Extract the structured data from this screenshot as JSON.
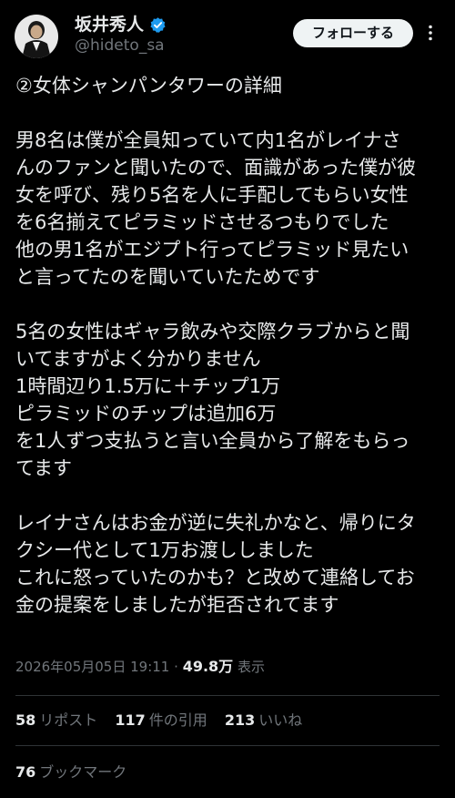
{
  "author": {
    "display_name": "坂井秀人",
    "handle": "@hideto_sa",
    "verified_icon": "verified-badge-icon",
    "avatar": "profile-photo"
  },
  "header": {
    "follow_label": "フォローする",
    "more_icon": "more-dots-icon"
  },
  "tweet": {
    "lines": [
      "②女体シャンパンタワーの詳細",
      "",
      "男8名は僕が全員知っていて内1名がレイナさ",
      "んのファンと聞いたので、面識があった僕が彼",
      "女を呼び、残り5名を人に手配してもらい女性",
      "を6名揃えてピラミッドさせるつもりでした",
      "他の男1名がエジプト行ってピラミッド見たい",
      "と言ってたのを聞いていたためです",
      "",
      "5名の女性はギャラ飲みや交際クラブからと聞",
      "いてますがよく分かりません",
      "1時間辺り1.5万に＋チップ1万",
      "ピラミッドのチップは追加6万",
      "を1人ずつ支払うと言い全員から了解をもらっ",
      "てます",
      "",
      "レイナさんはお金が逆に失礼かなと、帰りにタ",
      "クシー代として1万お渡ししました",
      "これに怒っていたのかも？と改めて連絡してお",
      "金の提案をしましたが拒否されてます"
    ]
  },
  "meta": {
    "timestamp": "2026年05月05日 19:11",
    "separator": "·",
    "views_count": "49.8万",
    "views_label": "表示"
  },
  "stats": {
    "reposts_count": "58",
    "reposts_label": "リポスト",
    "quotes_count": "117",
    "quotes_label": "件の引用",
    "likes_count": "213",
    "likes_label": "いいね",
    "bookmarks_count": "76",
    "bookmarks_label": "ブックマーク"
  },
  "colors": {
    "background": "#000000",
    "text_primary": "#e7e9ea",
    "text_secondary": "#71767b",
    "divider": "#2f3336",
    "verified_blue": "#1d9bf0",
    "follow_bg": "#eff3f4"
  }
}
